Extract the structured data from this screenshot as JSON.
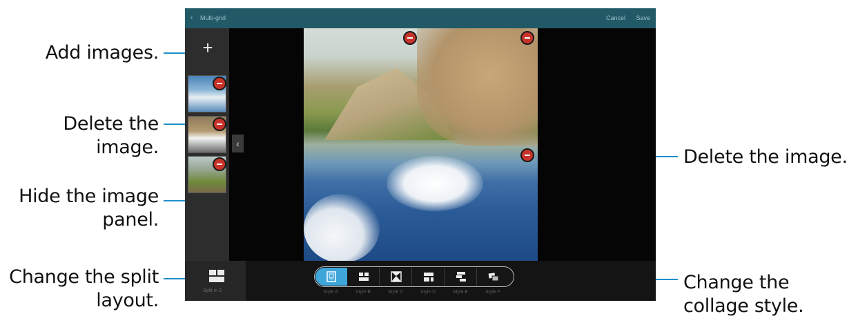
{
  "callouts": {
    "add_images": "Add images.",
    "delete_image_left": "Delete the image.",
    "hide_panel": "Hide the image panel.",
    "change_split": "Change the split layout.",
    "delete_image_right": "Delete the image.",
    "change_style": "Change the collage style."
  },
  "app": {
    "title": "Multi-grid",
    "cancel": "Cancel",
    "save": "Save"
  },
  "bottombar": {
    "split_label": "Split in 3",
    "style_labels": [
      "Style A",
      "Style B",
      "Style C",
      "Style D",
      "Style E",
      "Style F"
    ]
  },
  "colors": {
    "accent_line": "#1e8fc9",
    "selected_style": "#3ea6d9",
    "delete_button": "#c8342a",
    "titlebar": "#215967"
  }
}
